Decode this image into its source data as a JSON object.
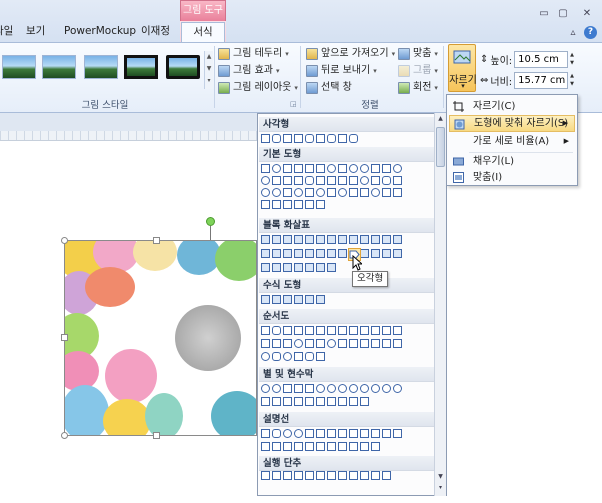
{
  "tabs": {
    "context_header": "그림 도구",
    "items": [
      "파일",
      "보기",
      "PowerMockup",
      "이재정"
    ],
    "active": "서식"
  },
  "window": {
    "minimize": "▭",
    "restore": "▢",
    "close": "✕",
    "collapse": "▵",
    "help": "?"
  },
  "ribbon": {
    "picture_styles": {
      "label": "그림 스타일",
      "border": "그림 테두리",
      "effects": "그림 효과",
      "layout": "그림 레이아웃"
    },
    "arrange": {
      "label": "정렬",
      "bring_forward": "앞으로 가져오기",
      "send_backward": "뒤로 보내기",
      "selection_pane": "선택 창",
      "align": "맞춤",
      "group": "그룹",
      "rotate": "회전"
    },
    "size": {
      "crop": "자르기",
      "height_label": "높이:",
      "height_value": "10.5 cm",
      "width_label": "너비:",
      "width_value": "15.77 cm"
    }
  },
  "crop_menu": {
    "crop": "자르기(C)",
    "crop_to_shape": "도형에 맞춰 자르기(S)",
    "aspect_ratio": "가로 세로 비율(A)",
    "fill": "채우기(L)",
    "fit": "맞춤(I)"
  },
  "shapes_panel": {
    "sections": [
      "사각형",
      "기본 도형",
      "블록 화살표",
      "수식 도형",
      "순서도",
      "별 및 현수막",
      "설명선",
      "실행 단추"
    ],
    "tooltip": "오각형"
  },
  "colors": {
    "accent": "#e9809a",
    "highlight": "#f7d983",
    "ribbon_border": "#a9bcd9"
  }
}
